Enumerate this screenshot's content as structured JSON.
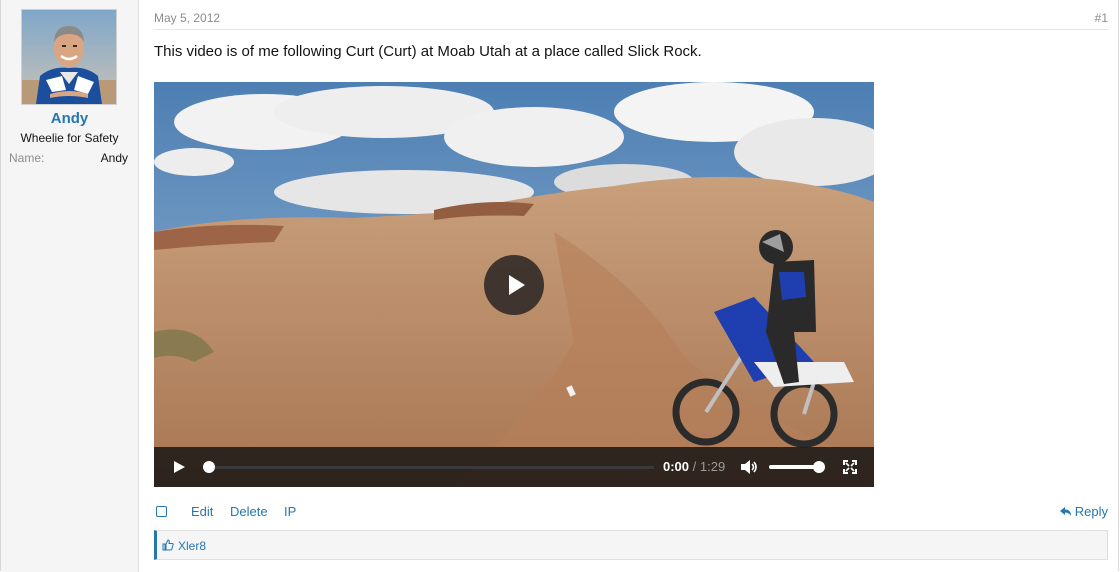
{
  "user": {
    "name": "Andy",
    "title": "Wheelie for Safety",
    "extra_label": "Name:",
    "extra_value": "Andy"
  },
  "post": {
    "date": "May 5, 2012",
    "number": "#1",
    "message": "This video is of me following Curt (Curt) at Moab Utah at a place called Slick Rock."
  },
  "video": {
    "current_time": "0:00",
    "separator": "/",
    "duration": "1:29",
    "progress": 0.0,
    "volume": 0.9
  },
  "actions": {
    "edit": "Edit",
    "delete": "Delete",
    "ip": "IP",
    "reply": "Reply"
  },
  "likes": {
    "liker": "Xler8"
  },
  "colors": {
    "link": "#2577b1",
    "muted": "#8c8c8c",
    "sidebar_bg": "#f5f5f5"
  },
  "icons": [
    "play-icon",
    "volume-icon",
    "fullscreen-icon",
    "reply-icon",
    "thumbs-up-icon"
  ]
}
